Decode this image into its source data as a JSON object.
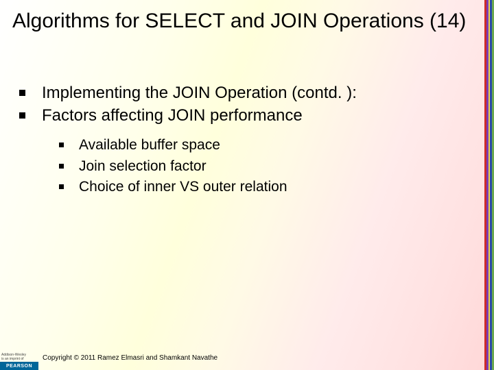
{
  "title": "Algorithms for SELECT and JOIN Operations (14)",
  "bullets": {
    "level1": [
      "Implementing the JOIN Operation (contd. ):",
      "Factors affecting JOIN performance"
    ],
    "level2": [
      "Available buffer space",
      "Join selection factor",
      "Choice of inner VS outer relation"
    ]
  },
  "logo": {
    "top_line1": "Addison-Wesley",
    "top_line2": "is an imprint of",
    "brand": "PEARSON"
  },
  "copyright": "Copyright © 2011 Ramez Elmasri and Shamkant Navathe"
}
